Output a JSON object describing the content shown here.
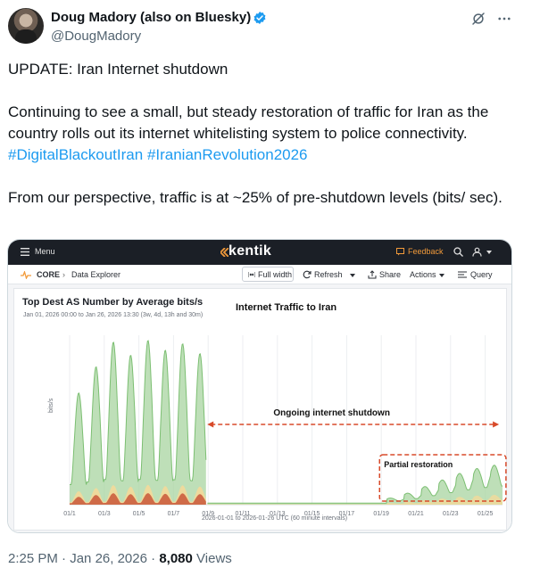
{
  "author": {
    "name": "Doug Madory (also on Bluesky)",
    "handle": "@DougMadory",
    "verified": true,
    "verified_color": "#1d9bf0"
  },
  "tweet": {
    "line1": "UPDATE: Iran Internet shutdown",
    "para2": "Continuing to see a small, but steady restoration of traffic for Iran as the country rolls out its internet whitelisting system to police connectivity.",
    "hashtags": [
      "#DigitalBlackoutIran",
      "#IranianRevolution2026"
    ],
    "para3": "From our perspective, traffic is at ~25% of pre-shutdown levels (bits/ sec).",
    "time": "2:25 PM",
    "date": "Jan 26, 2026",
    "views_count": "8,080",
    "views_label": "Views"
  },
  "kentik": {
    "menu_label": "Menu",
    "logo": "kentik",
    "feedback": "Feedback",
    "breadcrumb_core": "CORE",
    "breadcrumb_page": "Data Explorer",
    "full_width": "Full width",
    "refresh": "Refresh",
    "share": "Share",
    "actions": "Actions",
    "query": "Query",
    "panel_title": "Top Dest AS Number by Average bits/s",
    "panel_subtitle": "Jan 01, 2026 00:00 to Jan 26, 2026 13:30 (3w, 4d, 13h and 30m)",
    "accent_orange": "#f29a3a",
    "bar_bg": "#1b1f26"
  },
  "chart_data": {
    "type": "area",
    "title": "Internet Traffic to Iran",
    "xlabel": "2026-01-01 to 2026-01-26 UTC (60 minute intervals)",
    "ylabel": "bits/s",
    "x_ticks": [
      "01/1",
      "01/3",
      "01/5",
      "01/7",
      "01/9",
      "01/11",
      "01/13",
      "01/15",
      "01/17",
      "01/19",
      "01/21",
      "01/23",
      "01/25"
    ],
    "x_range": [
      "2026-01-01",
      "2026-01-26"
    ],
    "grid": true,
    "annotations": [
      {
        "text": "Ongoing internet shutdown",
        "from": "2026-01-08",
        "to": "2026-01-26"
      },
      {
        "text": "Partial restoration",
        "from": "2026-01-19",
        "to": "2026-01-26"
      }
    ],
    "series_relative": {
      "description_daily_peaks_pre_shutdown": [
        0.62,
        0.78,
        0.93,
        0.85,
        0.94,
        0.88,
        0.92,
        0.86
      ],
      "shutdown_level": 0.01,
      "restoration_peaks": [
        0.03,
        0.06,
        0.1,
        0.14,
        0.18,
        0.21,
        0.23,
        0.25
      ]
    },
    "colors": {
      "area_top": "#a8d4a0",
      "area_line": "#7cbf72",
      "area_mid": "#f3d99a",
      "area_base": "#c9573a",
      "arrow": "#d84a2a"
    }
  }
}
